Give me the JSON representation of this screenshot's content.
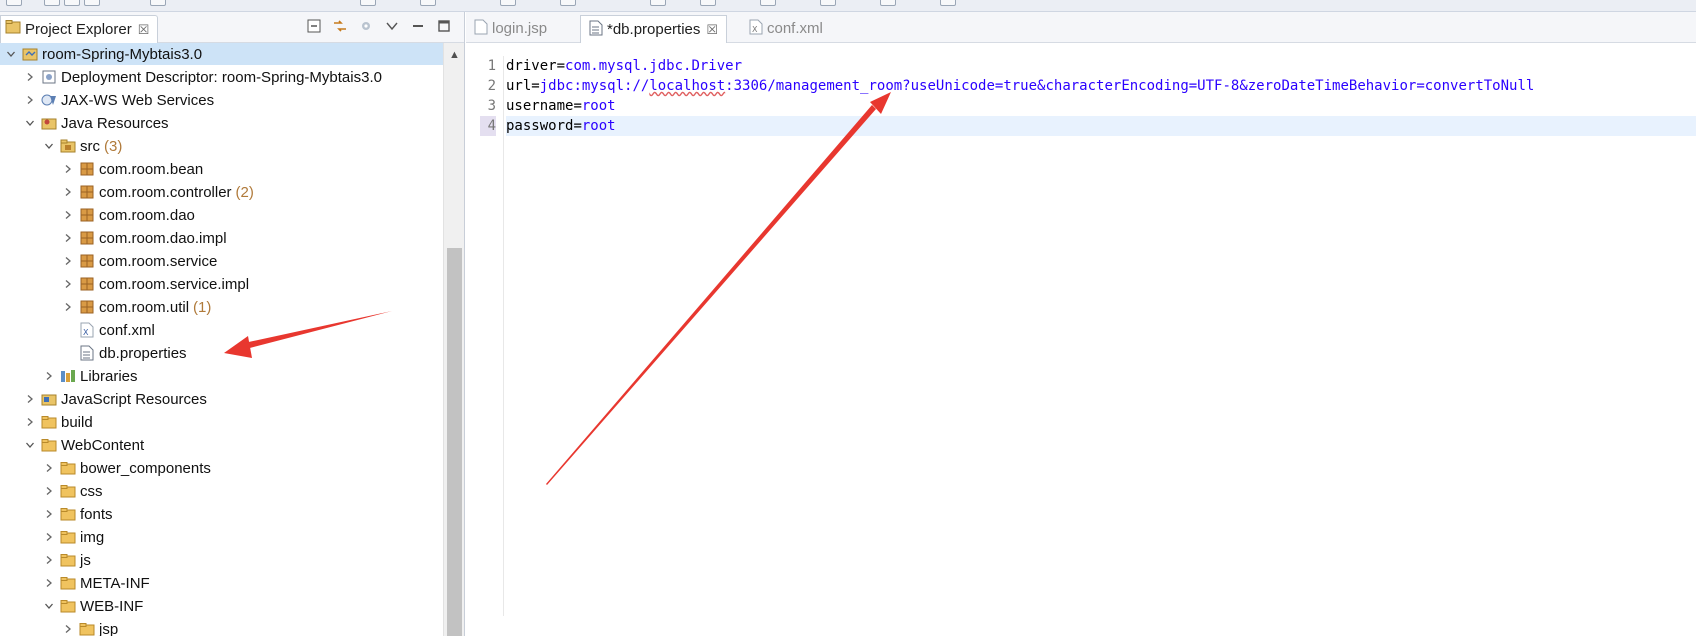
{
  "explorer": {
    "tab_title": "Project Explorer",
    "tab_close": "☒",
    "tree": [
      {
        "label": "room-Spring-Mybtais3.0",
        "icon": "project-icon",
        "expanded": true,
        "selected": true
      },
      {
        "label": "Deployment Descriptor: room-Spring-Mybtais3.0",
        "icon": "deployment-descriptor-icon"
      },
      {
        "label": "JAX-WS Web Services",
        "icon": "web-services-icon"
      },
      {
        "label": "Java Resources",
        "icon": "java-resources-icon",
        "expanded": true
      },
      {
        "label": "src",
        "count": "(3)",
        "icon": "source-folder-icon",
        "expanded": true
      },
      {
        "label": "com.room.bean",
        "icon": "package-icon"
      },
      {
        "label": "com.room.controller",
        "count": "(2)",
        "icon": "package-icon"
      },
      {
        "label": "com.room.dao",
        "icon": "package-icon"
      },
      {
        "label": "com.room.dao.impl",
        "icon": "package-icon"
      },
      {
        "label": "com.room.service",
        "icon": "package-icon"
      },
      {
        "label": "com.room.service.impl",
        "icon": "package-icon"
      },
      {
        "label": "com.room.util",
        "count": "(1)",
        "icon": "package-icon"
      },
      {
        "label": "conf.xml",
        "icon": "xml-file-icon"
      },
      {
        "label": "db.properties",
        "icon": "properties-file-icon"
      },
      {
        "label": "Libraries",
        "icon": "libraries-icon"
      },
      {
        "label": "JavaScript Resources",
        "icon": "javascript-resources-icon"
      },
      {
        "label": "build",
        "icon": "folder-icon"
      },
      {
        "label": "WebContent",
        "icon": "folder-icon",
        "expanded": true
      },
      {
        "label": "bower_components",
        "icon": "folder-icon"
      },
      {
        "label": "css",
        "icon": "folder-icon"
      },
      {
        "label": "fonts",
        "icon": "folder-icon"
      },
      {
        "label": "img",
        "icon": "folder-icon"
      },
      {
        "label": "js",
        "icon": "folder-icon"
      },
      {
        "label": "META-INF",
        "icon": "folder-icon"
      },
      {
        "label": "WEB-INF",
        "icon": "folder-icon",
        "expanded": true
      },
      {
        "label": "jsp",
        "icon": "folder-icon"
      }
    ]
  },
  "editor": {
    "tabs": [
      {
        "label": "login.jsp",
        "icon": "jsp-file-icon",
        "active": false
      },
      {
        "label": "*db.properties",
        "icon": "properties-file-icon",
        "active": true,
        "close": "☒"
      },
      {
        "label": "conf.xml",
        "icon": "xml-file-icon",
        "active": false
      }
    ],
    "lines": [
      {
        "number": "1",
        "key": "driver",
        "eq": "=",
        "value": "com.mysql.jdbc.Driver"
      },
      {
        "number": "2",
        "key": "url",
        "eq": "=",
        "value_pre": "jdbc:mysql://",
        "value_sq": "localhost",
        "value_post": ":3306/management_room?useUnicode=true&characterEncoding=UTF-8&zeroDateTimeBehavior=convertToNull"
      },
      {
        "number": "3",
        "key": "username",
        "eq": "=",
        "value": "root"
      },
      {
        "number": "4",
        "key": "password",
        "eq": "=",
        "value": "root",
        "current": true
      }
    ]
  },
  "colors": {
    "annotation_arrow": "#e8372f",
    "selection": "#cde3f7",
    "property_value": "#2a00ff",
    "package_count": "#b07a3a"
  }
}
